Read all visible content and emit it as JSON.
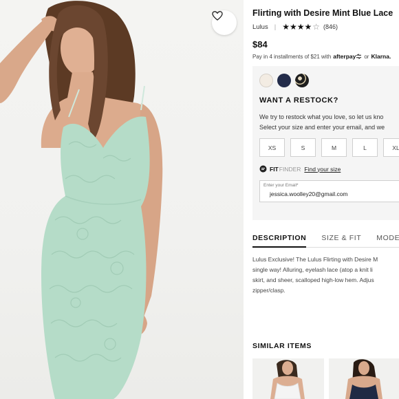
{
  "product": {
    "title": "Flirting with Desire Mint Blue Lace",
    "brand": "Lulus",
    "brand_separator": "|",
    "stars_filled": "★★★★",
    "stars_empty": "☆",
    "rating_value": 4,
    "rating_count": "(846)",
    "price": "$84",
    "installments_text": "Pay in 4 installments of $21 with",
    "afterpay_label": "afterpay",
    "afterpay_icon": "afterpay-arrows-icon",
    "or_label": "or",
    "klarna_label": "Klarna."
  },
  "photo": {
    "favorite_icon": "heart-icon",
    "dress_color": "#b5dcc8"
  },
  "swatches": [
    {
      "color": "#f3ece3",
      "name": "cream"
    },
    {
      "color": "#232c4a",
      "name": "navy"
    },
    {
      "color": "#1e1e1e",
      "name": "black-floral"
    }
  ],
  "restock": {
    "title": "WANT A RESTOCK?",
    "line1": "We try to restock what you love, so let us kno",
    "line2": "Select your size and enter your email, and we",
    "sizes": [
      "XS",
      "S",
      "M",
      "L",
      "XL"
    ],
    "fit_icon": "fit-finder-icon",
    "fit_label": "FIT",
    "finder_label": "FINDER",
    "fit_link": "Find your size",
    "email_label": "Enter your Email*",
    "email_value": "jessica.woolley20@gmail.com"
  },
  "tabs": [
    "DESCRIPTION",
    "SIZE & FIT",
    "MODE"
  ],
  "description": {
    "line1": "Lulus Exclusive! The Lulus Flirting with Desire M",
    "line2": "single way! Alluring, eyelash lace (atop a knit li",
    "line3": "skirt, and sheer, scalloped high-low hem. Adjus",
    "line4": "zipper/clasp."
  },
  "similar": {
    "title": "SIMILAR ITEMS"
  },
  "colors": {
    "accent": "#111111",
    "panel_bg": "#f5f5f5"
  }
}
